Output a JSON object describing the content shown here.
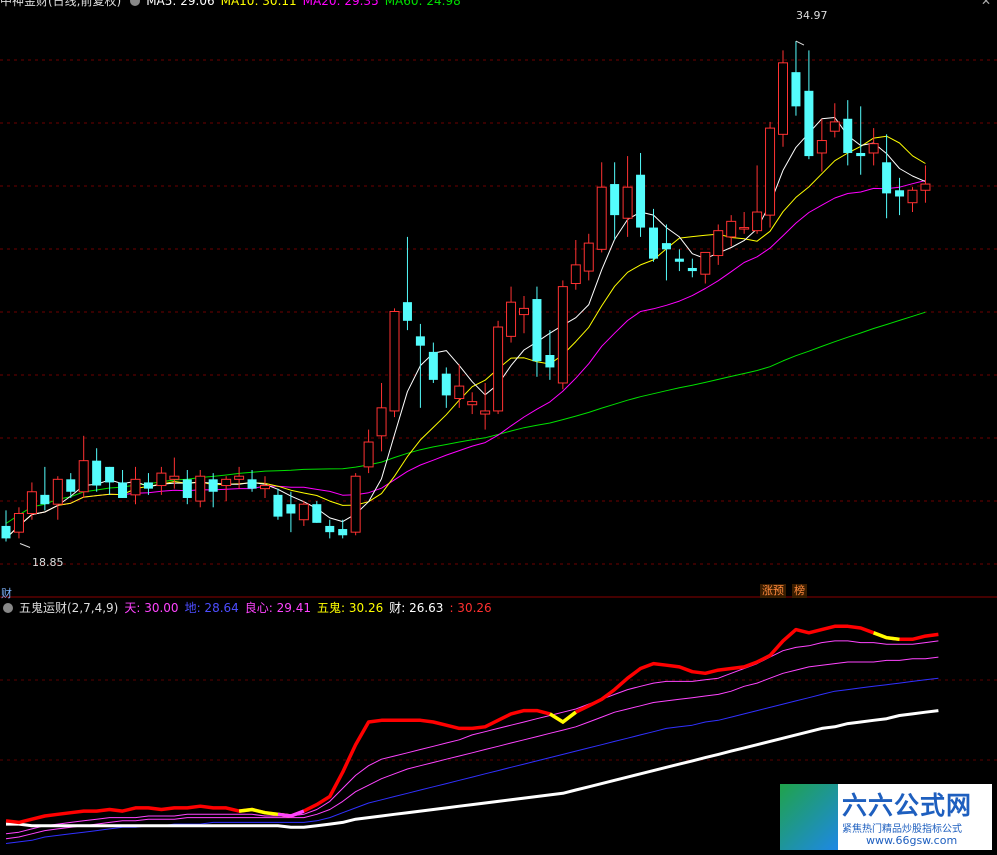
{
  "top_header": {
    "title": "中神金财(日线,前复权)",
    "ma5": "MA5: 29.06",
    "ma10": "MA10: 30.11",
    "ma20": "MA20: 29.35",
    "ma60": "MA60: 24.98"
  },
  "price_annotations": {
    "high": "34.97",
    "low": "18.85"
  },
  "left_label": "财",
  "tags": {
    "zhangyu": "涨预",
    "bang": "榜"
  },
  "indicator_header": {
    "name": "五鬼运财(2,7,4,9)",
    "tian": "天: 30.00",
    "di": "地: 28.64",
    "liangxin": "良心: 29.41",
    "wugui": "五鬼: 30.26",
    "cai": "财: 26.63",
    "extra": ": 30.26"
  },
  "watermark": {
    "brand": "六六公式网",
    "slogan": "紧焦热门精品炒股指标公式",
    "url": "www.66gsw.com"
  },
  "colors": {
    "up": "#ff3232",
    "down": "#54fcfc",
    "ma5": "#ffffff",
    "ma10": "#ffff00",
    "ma20": "#ff00ff",
    "ma60": "#00e000",
    "red_line": "#ff0000",
    "yellow": "#ffff00",
    "magenta": "#ff44ff",
    "blue": "#3030ff"
  },
  "chart_data": [
    {
      "type": "candlestick",
      "title": "中神金财(日线,前复权)",
      "ylim": [
        17.5,
        36.0
      ],
      "candles": [
        [
          19.4,
          19.9,
          18.9,
          19.0
        ],
        [
          19.2,
          20.0,
          19.0,
          19.8
        ],
        [
          19.8,
          20.8,
          19.6,
          20.5
        ],
        [
          20.4,
          21.3,
          19.9,
          20.1
        ],
        [
          20.1,
          21.0,
          19.6,
          20.9
        ],
        [
          20.9,
          21.1,
          20.3,
          20.5
        ],
        [
          20.5,
          22.3,
          20.3,
          21.5
        ],
        [
          21.5,
          21.9,
          20.5,
          20.7
        ],
        [
          21.3,
          21.3,
          20.4,
          20.8
        ],
        [
          20.8,
          21.2,
          20.3,
          20.3
        ],
        [
          20.4,
          21.3,
          20.1,
          20.9
        ],
        [
          20.8,
          21.1,
          20.4,
          20.6
        ],
        [
          20.7,
          21.3,
          20.4,
          21.1
        ],
        [
          20.9,
          21.6,
          20.6,
          21.0
        ],
        [
          20.9,
          21.2,
          20.1,
          20.3
        ],
        [
          20.2,
          21.2,
          20.0,
          21.0
        ],
        [
          20.9,
          21.1,
          20.0,
          20.5
        ],
        [
          20.7,
          21.0,
          20.2,
          20.9
        ],
        [
          20.9,
          21.3,
          20.6,
          21.0
        ],
        [
          20.9,
          21.2,
          20.5,
          20.6
        ],
        [
          20.6,
          21.0,
          20.3,
          20.7
        ],
        [
          20.4,
          20.6,
          19.6,
          19.7
        ],
        [
          20.1,
          20.5,
          19.2,
          19.8
        ],
        [
          19.6,
          20.2,
          19.4,
          20.1
        ],
        [
          20.1,
          20.2,
          19.5,
          19.5
        ],
        [
          19.4,
          19.6,
          19.0,
          19.2
        ],
        [
          19.3,
          19.6,
          19.0,
          19.1
        ],
        [
          19.2,
          21.1,
          19.1,
          21.0
        ],
        [
          21.3,
          22.5,
          21.1,
          22.1
        ],
        [
          22.3,
          24.0,
          21.8,
          23.2
        ],
        [
          23.1,
          26.4,
          22.9,
          26.3
        ],
        [
          26.6,
          28.7,
          25.7,
          26.0
        ],
        [
          25.5,
          25.9,
          23.2,
          25.2
        ],
        [
          25.0,
          25.3,
          24.0,
          24.1
        ],
        [
          24.3,
          24.5,
          23.2,
          23.6
        ],
        [
          23.5,
          24.6,
          23.2,
          23.9
        ],
        [
          23.3,
          23.7,
          23.0,
          23.4
        ],
        [
          23.0,
          24.0,
          22.5,
          23.1
        ],
        [
          23.1,
          26.0,
          23.0,
          25.8
        ],
        [
          25.5,
          27.1,
          25.3,
          26.6
        ],
        [
          26.2,
          26.8,
          25.6,
          26.4
        ],
        [
          26.7,
          27.1,
          24.2,
          24.7
        ],
        [
          24.9,
          25.7,
          24.1,
          24.5
        ],
        [
          24.0,
          27.3,
          23.8,
          27.1
        ],
        [
          27.2,
          28.6,
          27.0,
          27.8
        ],
        [
          27.6,
          28.8,
          27.3,
          28.5
        ],
        [
          28.3,
          31.1,
          28.2,
          30.3
        ],
        [
          30.4,
          31.1,
          28.6,
          29.4
        ],
        [
          29.3,
          31.3,
          28.7,
          30.3
        ],
        [
          30.7,
          31.4,
          28.7,
          29.0
        ],
        [
          29.0,
          29.6,
          27.9,
          28.0
        ],
        [
          28.5,
          29.1,
          27.3,
          28.3
        ],
        [
          28.0,
          28.3,
          27.6,
          27.9
        ],
        [
          27.7,
          28.0,
          27.4,
          27.6
        ],
        [
          27.5,
          28.2,
          27.2,
          28.2
        ],
        [
          28.1,
          29.1,
          27.8,
          28.9
        ],
        [
          28.7,
          29.4,
          28.4,
          29.2
        ],
        [
          29.0,
          29.5,
          28.8,
          29.0
        ],
        [
          28.9,
          31.0,
          28.8,
          29.5
        ],
        [
          29.4,
          32.4,
          29.0,
          32.2
        ],
        [
          32.0,
          34.7,
          31.6,
          34.3
        ],
        [
          34.0,
          35.0,
          32.6,
          32.9
        ],
        [
          33.4,
          34.7,
          31.2,
          31.3
        ],
        [
          31.4,
          32.5,
          30.8,
          31.8
        ],
        [
          32.1,
          33.0,
          31.9,
          32.4
        ],
        [
          32.5,
          33.1,
          31.0,
          31.4
        ],
        [
          31.4,
          32.9,
          30.7,
          31.3
        ],
        [
          31.4,
          32.2,
          31.0,
          31.7
        ],
        [
          31.1,
          32.0,
          29.3,
          30.1
        ],
        [
          30.2,
          30.6,
          29.4,
          30.0
        ],
        [
          29.8,
          30.3,
          29.5,
          30.2
        ],
        [
          30.2,
          31.0,
          29.8,
          30.4
        ]
      ],
      "ma5_last": 29.06,
      "ma10_last": 30.11,
      "ma20_last": 29.35,
      "ma60_last": 24.98,
      "annotations": [
        {
          "label": "34.97",
          "type": "high"
        },
        {
          "label": "18.85",
          "type": "low"
        }
      ]
    },
    {
      "type": "line",
      "title": "五鬼运财(2,7,4,9)",
      "series": [
        {
          "name": "五鬼",
          "values": [
            19.8,
            19.7,
            19.9,
            20.1,
            20.2,
            20.3,
            20.4,
            20.4,
            20.5,
            20.4,
            20.6,
            20.6,
            20.5,
            20.6,
            20.6,
            20.7,
            20.6,
            20.6,
            20.4,
            20.5,
            20.3,
            20.2,
            20.1,
            20.4,
            20.8,
            21.3,
            22.8,
            24.5,
            25.9,
            26.0,
            26.0,
            26.0,
            26.0,
            25.9,
            25.7,
            25.5,
            25.5,
            25.6,
            26.0,
            26.4,
            26.6,
            26.6,
            26.4,
            25.9,
            26.5,
            26.9,
            27.3,
            27.9,
            28.6,
            29.2,
            29.5,
            29.4,
            29.3,
            29.0,
            28.9,
            29.1,
            29.2,
            29.3,
            29.6,
            30.0,
            30.9,
            31.6,
            31.4,
            31.6,
            31.8,
            31.8,
            31.7,
            31.4,
            31.1,
            31.0,
            31.0,
            31.2,
            31.3
          ]
        },
        {
          "name": "天",
          "values": [
            19.0,
            19.1,
            19.3,
            19.5,
            19.6,
            19.7,
            19.8,
            19.9,
            20.0,
            20.0,
            20.0,
            20.1,
            20.1,
            20.1,
            20.2,
            20.2,
            20.2,
            20.2,
            20.2,
            20.2,
            20.1,
            20.1,
            20.1,
            20.2,
            20.5,
            21.0,
            21.8,
            22.6,
            23.2,
            23.6,
            23.8,
            24.0,
            24.2,
            24.4,
            24.6,
            24.8,
            25.1,
            25.3,
            25.5,
            25.7,
            25.9,
            26.1,
            26.3,
            26.5,
            26.7,
            27.0,
            27.3,
            27.6,
            27.9,
            28.1,
            28.3,
            28.4,
            28.4,
            28.4,
            28.5,
            28.6,
            28.9,
            29.2,
            29.5,
            29.9,
            30.3,
            30.5,
            30.6,
            30.8,
            30.9,
            30.9,
            30.8,
            30.8,
            30.7,
            30.7,
            30.7,
            30.8,
            30.9
          ]
        },
        {
          "name": "良心",
          "values": [
            18.7,
            18.8,
            19.0,
            19.2,
            19.3,
            19.4,
            19.5,
            19.6,
            19.7,
            19.8,
            19.8,
            19.9,
            19.9,
            19.9,
            20.0,
            20.0,
            20.0,
            20.0,
            20.0,
            20.0,
            20.0,
            20.0,
            20.0,
            20.0,
            20.2,
            20.5,
            21.0,
            21.6,
            22.0,
            22.4,
            22.7,
            23.0,
            23.2,
            23.4,
            23.6,
            23.8,
            24.0,
            24.2,
            24.4,
            24.6,
            24.8,
            25.0,
            25.2,
            25.4,
            25.6,
            25.9,
            26.2,
            26.5,
            26.7,
            26.9,
            27.1,
            27.2,
            27.3,
            27.4,
            27.5,
            27.6,
            27.8,
            28.1,
            28.3,
            28.6,
            28.9,
            29.1,
            29.3,
            29.4,
            29.5,
            29.6,
            29.6,
            29.6,
            29.7,
            29.7,
            29.8,
            29.8,
            29.9
          ]
        },
        {
          "name": "地",
          "values": [
            18.4,
            18.5,
            18.6,
            18.8,
            18.9,
            19.0,
            19.1,
            19.2,
            19.3,
            19.4,
            19.4,
            19.5,
            19.5,
            19.6,
            19.6,
            19.6,
            19.7,
            19.7,
            19.7,
            19.7,
            19.7,
            19.7,
            19.7,
            19.7,
            19.8,
            20.0,
            20.3,
            20.6,
            20.9,
            21.1,
            21.3,
            21.5,
            21.7,
            21.9,
            22.1,
            22.3,
            22.5,
            22.7,
            22.9,
            23.1,
            23.3,
            23.5,
            23.7,
            23.9,
            24.1,
            24.3,
            24.5,
            24.7,
            24.9,
            25.1,
            25.3,
            25.5,
            25.6,
            25.7,
            25.9,
            26.0,
            26.2,
            26.4,
            26.6,
            26.8,
            27.0,
            27.2,
            27.4,
            27.6,
            27.8,
            27.9,
            28.0,
            28.1,
            28.2,
            28.3,
            28.4,
            28.5,
            28.6
          ]
        },
        {
          "name": "财",
          "values": [
            19.6,
            19.6,
            19.5,
            19.5,
            19.5,
            19.5,
            19.5,
            19.5,
            19.5,
            19.5,
            19.5,
            19.5,
            19.5,
            19.5,
            19.5,
            19.5,
            19.5,
            19.5,
            19.5,
            19.5,
            19.5,
            19.5,
            19.4,
            19.4,
            19.5,
            19.6,
            19.7,
            19.9,
            20.0,
            20.1,
            20.2,
            20.3,
            20.4,
            20.5,
            20.6,
            20.7,
            20.8,
            20.9,
            21.0,
            21.1,
            21.2,
            21.3,
            21.4,
            21.5,
            21.7,
            21.9,
            22.1,
            22.3,
            22.5,
            22.7,
            22.9,
            23.1,
            23.3,
            23.5,
            23.7,
            23.9,
            24.1,
            24.3,
            24.5,
            24.7,
            24.9,
            25.1,
            25.3,
            25.5,
            25.6,
            25.8,
            25.9,
            26.0,
            26.1,
            26.3,
            26.4,
            26.5,
            26.6
          ]
        }
      ],
      "yellow_segments": [
        [
          18,
          22
        ],
        [
          42,
          44
        ],
        [
          67,
          69
        ]
      ],
      "magenta_segments": [
        [
          21,
          23
        ]
      ],
      "ylim": [
        18.0,
        32.5
      ]
    }
  ]
}
